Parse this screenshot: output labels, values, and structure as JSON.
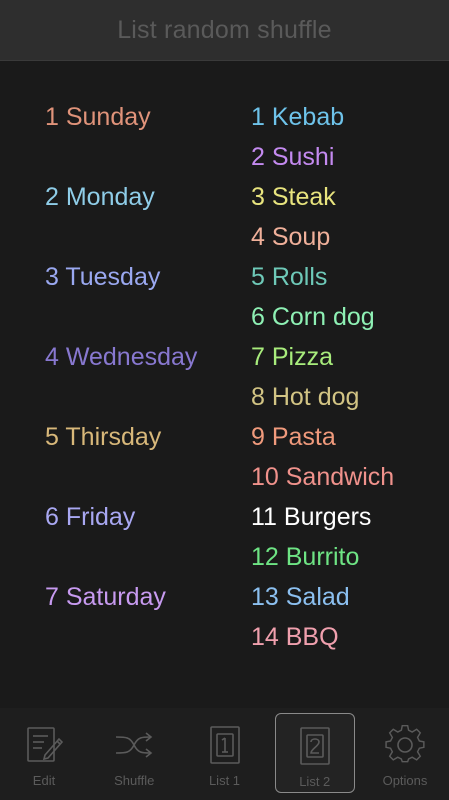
{
  "header": {
    "title": "List random shuffle"
  },
  "list1": [
    {
      "text": "1 Sunday",
      "color": "#e0937a"
    },
    {
      "text": "2 Monday",
      "color": "#8fcde8"
    },
    {
      "text": "3 Tuesday",
      "color": "#9aa8f0"
    },
    {
      "text": "4 Wednesday",
      "color": "#8878d0"
    },
    {
      "text": "5 Thirsday",
      "color": "#d8b87a"
    },
    {
      "text": "6 Friday",
      "color": "#a9a8f2"
    },
    {
      "text": "7 Saturday",
      "color": "#c79af0"
    }
  ],
  "list2": [
    {
      "text": "1 Kebab",
      "color": "#6ec3ea"
    },
    {
      "text": "2 Sushi",
      "color": "#c48af0"
    },
    {
      "text": "3 Steak",
      "color": "#e8e47e"
    },
    {
      "text": "4 Soup",
      "color": "#f0b09a"
    },
    {
      "text": "5 Rolls",
      "color": "#6ec9b8"
    },
    {
      "text": "6 Corn dog",
      "color": "#8ef0b4"
    },
    {
      "text": "7 Pizza",
      "color": "#a8ec7c"
    },
    {
      "text": "8 Hot dog",
      "color": "#d2c484"
    },
    {
      "text": "9 Pasta",
      "color": "#f09a7c"
    },
    {
      "text": "10 Sandwich",
      "color": "#f0928c"
    },
    {
      "text": "11 Burgers",
      "color": "#ffffff"
    },
    {
      "text": "12 Burrito",
      "color": "#6ee484"
    },
    {
      "text": "13 Salad",
      "color": "#8cc0f0"
    },
    {
      "text": "14 BBQ",
      "color": "#f0a0ae"
    }
  ],
  "tabs": [
    {
      "label": "Edit",
      "icon": "edit-icon",
      "active": false
    },
    {
      "label": "Shuffle",
      "icon": "shuffle-icon",
      "active": false
    },
    {
      "label": "List 1",
      "icon": "list-1-icon",
      "active": false
    },
    {
      "label": "List 2",
      "icon": "list-2-icon",
      "active": true
    },
    {
      "label": "Options",
      "icon": "gear-icon",
      "active": false
    }
  ]
}
